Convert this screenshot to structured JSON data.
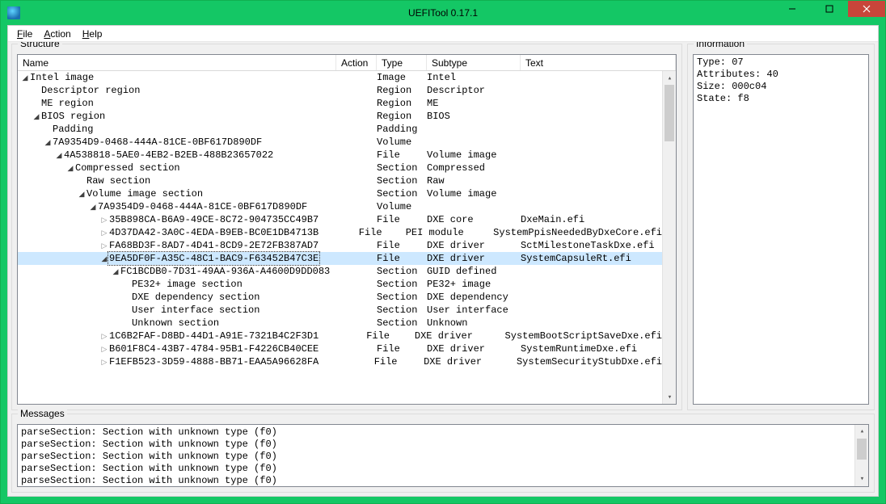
{
  "window": {
    "title": "UEFITool 0.17.1"
  },
  "menu": {
    "file": "File",
    "action": "Action",
    "help": "Help"
  },
  "panels": {
    "structure": "Structure",
    "information": "Information",
    "messages": "Messages"
  },
  "columns": {
    "name": "Name",
    "action": "Action",
    "type": "Type",
    "subtype": "Subtype",
    "text": "Text"
  },
  "tree": [
    {
      "depth": 0,
      "twisty": "▾",
      "name": "Intel image",
      "type": "Image",
      "subtype": "Intel",
      "text": ""
    },
    {
      "depth": 1,
      "twisty": "",
      "name": "Descriptor region",
      "type": "Region",
      "subtype": "Descriptor",
      "text": ""
    },
    {
      "depth": 1,
      "twisty": "",
      "name": "ME region",
      "type": "Region",
      "subtype": "ME",
      "text": ""
    },
    {
      "depth": 1,
      "twisty": "▾",
      "name": "BIOS region",
      "type": "Region",
      "subtype": "BIOS",
      "text": ""
    },
    {
      "depth": 2,
      "twisty": "",
      "name": "Padding",
      "type": "Padding",
      "subtype": "",
      "text": ""
    },
    {
      "depth": 2,
      "twisty": "▾",
      "name": "7A9354D9-0468-444A-81CE-0BF617D890DF",
      "type": "Volume",
      "subtype": "",
      "text": ""
    },
    {
      "depth": 3,
      "twisty": "▾",
      "name": "4A538818-5AE0-4EB2-B2EB-488B23657022",
      "type": "File",
      "subtype": "Volume image",
      "text": ""
    },
    {
      "depth": 4,
      "twisty": "▾",
      "name": "Compressed section",
      "type": "Section",
      "subtype": "Compressed",
      "text": ""
    },
    {
      "depth": 5,
      "twisty": "",
      "name": "Raw section",
      "type": "Section",
      "subtype": "Raw",
      "text": ""
    },
    {
      "depth": 5,
      "twisty": "▾",
      "name": "Volume image section",
      "type": "Section",
      "subtype": "Volume image",
      "text": ""
    },
    {
      "depth": 6,
      "twisty": "▾",
      "name": "7A9354D9-0468-444A-81CE-0BF617D890DF",
      "type": "Volume",
      "subtype": "",
      "text": ""
    },
    {
      "depth": 7,
      "twisty": "▸",
      "name": "35B898CA-B6A9-49CE-8C72-904735CC49B7",
      "type": "File",
      "subtype": "DXE core",
      "text": "DxeMain.efi"
    },
    {
      "depth": 7,
      "twisty": "▸",
      "name": "4D37DA42-3A0C-4EDA-B9EB-BC0E1DB4713B",
      "type": "File",
      "subtype": "PEI module",
      "text": "SystemPpisNeededByDxeCore.efi"
    },
    {
      "depth": 7,
      "twisty": "▸",
      "name": "FA68BD3F-8AD7-4D41-8CD9-2E72FB387AD7",
      "type": "File",
      "subtype": "DXE driver",
      "text": "SctMilestoneTaskDxe.efi"
    },
    {
      "depth": 7,
      "twisty": "▾",
      "name": "9EA5DF0F-A35C-48C1-BAC9-F63452B47C3E",
      "type": "File",
      "subtype": "DXE driver",
      "text": "SystemCapsuleRt.efi",
      "selected": true
    },
    {
      "depth": 8,
      "twisty": "▾",
      "name": "FC1BCDB0-7D31-49AA-936A-A4600D9DD083",
      "type": "Section",
      "subtype": "GUID defined",
      "text": ""
    },
    {
      "depth": 9,
      "twisty": "",
      "name": "PE32+ image section",
      "type": "Section",
      "subtype": "PE32+ image",
      "text": ""
    },
    {
      "depth": 9,
      "twisty": "",
      "name": "DXE dependency section",
      "type": "Section",
      "subtype": "DXE dependency",
      "text": ""
    },
    {
      "depth": 9,
      "twisty": "",
      "name": "User interface section",
      "type": "Section",
      "subtype": "User interface",
      "text": ""
    },
    {
      "depth": 9,
      "twisty": "",
      "name": "Unknown section",
      "type": "Section",
      "subtype": "Unknown",
      "text": ""
    },
    {
      "depth": 7,
      "twisty": "▸",
      "name": "1C6B2FAF-D8BD-44D1-A91E-7321B4C2F3D1",
      "type": "File",
      "subtype": "DXE driver",
      "text": "SystemBootScriptSaveDxe.efi"
    },
    {
      "depth": 7,
      "twisty": "▸",
      "name": "B601F8C4-43B7-4784-95B1-F4226CB40CEE",
      "type": "File",
      "subtype": "DXE driver",
      "text": "SystemRuntimeDxe.efi"
    },
    {
      "depth": 7,
      "twisty": "▸",
      "name": "F1EFB523-3D59-4888-BB71-EAA5A96628FA",
      "type": "File",
      "subtype": "DXE driver",
      "text": "SystemSecurityStubDxe.efi"
    }
  ],
  "info": {
    "type": "Type: 07",
    "attributes": "Attributes: 40",
    "size": "Size: 000c04",
    "state": "State: f8"
  },
  "messages": [
    "parseSection: Section with unknown type (f0)",
    "parseSection: Section with unknown type (f0)",
    "parseSection: Section with unknown type (f0)",
    "parseSection: Section with unknown type (f0)",
    "parseSection: Section with unknown type (f0)"
  ]
}
